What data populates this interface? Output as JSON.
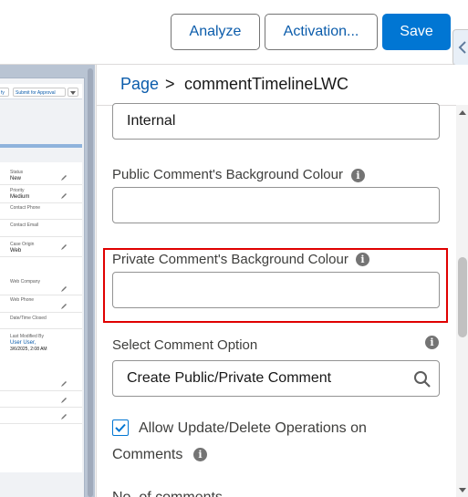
{
  "toolbar": {
    "analyze_label": "Analyze",
    "activation_label": "Activation...",
    "save_label": "Save"
  },
  "canvas_preview": {
    "header_buttons": [
      "fy",
      "Submit for Approval"
    ],
    "fields": [
      {
        "label": "Status",
        "value": "New"
      },
      {
        "label": "Priority",
        "value": "Medium"
      },
      {
        "label": "Contact Phone",
        "value": ""
      },
      {
        "label": "Contact Email",
        "value": ""
      },
      {
        "label": "Case Origin",
        "value": "Web"
      },
      {
        "label": "Web Company",
        "value": ""
      },
      {
        "label": "Web Phone",
        "value": ""
      },
      {
        "label": "Date/Time Closed",
        "value": ""
      },
      {
        "label": "Last Modified By",
        "value": "User User,"
      }
    ],
    "last_modified_date": "3/6/2025, 2:08 AM"
  },
  "breadcrumb": {
    "page": "Page",
    "separator": ">",
    "component": "commentTimelineLWC"
  },
  "properties": {
    "top_field_value": "Internal",
    "public_bg_label": "Public Comment's Background Colour",
    "public_bg_value": "",
    "private_bg_label": "Private Comment's Background Colour",
    "private_bg_value": "",
    "select_option_label": "Select Comment Option",
    "select_option_value": "Create Public/Private Comment",
    "allow_update_line1": "Allow Update/Delete Operations on",
    "allow_update_line2": "Comments",
    "allow_update_checked": true,
    "next_label_partial": "No. of comments"
  },
  "colors": {
    "brand": "#0176d3",
    "link": "#0b5cab",
    "highlight": "#e00000"
  }
}
